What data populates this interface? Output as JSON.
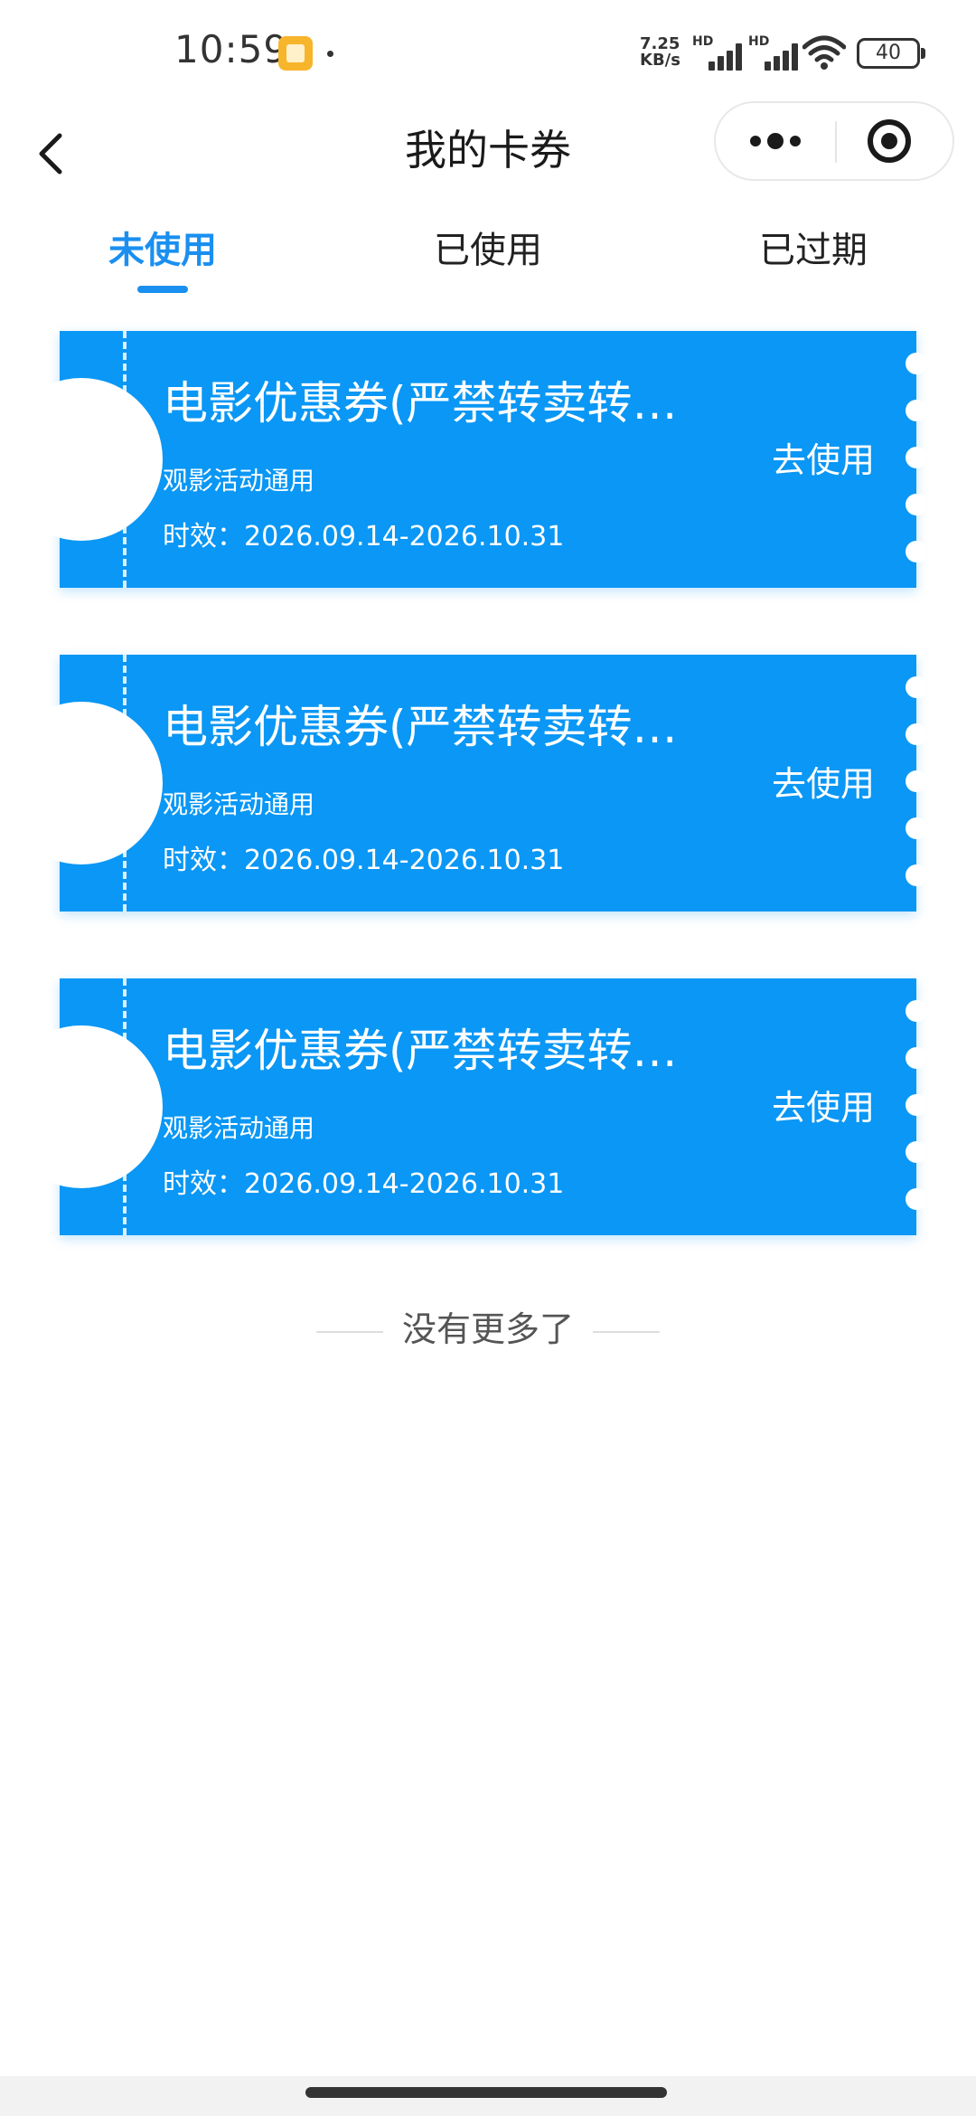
{
  "status_bar": {
    "time": "10:59",
    "net_speed_value": "7.25",
    "net_speed_unit": "KB/s",
    "sim1_label": "HD",
    "sim2_label": "HD",
    "battery": "40",
    "icons": [
      "app-notification-icon",
      "signal-icon",
      "wifi-icon",
      "battery-icon"
    ]
  },
  "nav": {
    "title": "我的卡券",
    "back_icon": "chevron-left-icon",
    "more_icon": "more-dots-icon",
    "close_icon": "target-close-icon"
  },
  "tabs": [
    {
      "label": "未使用",
      "active": true
    },
    {
      "label": "已使用",
      "active": false
    },
    {
      "label": "已过期",
      "active": false
    }
  ],
  "coupons": [
    {
      "title": "电影优惠券(严禁转卖转…",
      "subtitle": "观影活动通用",
      "validity": "时效：2026.09.14-2026.10.31",
      "action": "去使用"
    },
    {
      "title": "电影优惠券(严禁转卖转…",
      "subtitle": "观影活动通用",
      "validity": "时效：2026.09.14-2026.10.31",
      "action": "去使用"
    },
    {
      "title": "电影优惠券(严禁转卖转…",
      "subtitle": "观影活动通用",
      "validity": "时效：2026.09.14-2026.10.31",
      "action": "去使用"
    }
  ],
  "list_footer": "没有更多了",
  "colors": {
    "accent": "#1a8ff0",
    "coupon_bg": "#0a97f5",
    "text": "#222222"
  }
}
